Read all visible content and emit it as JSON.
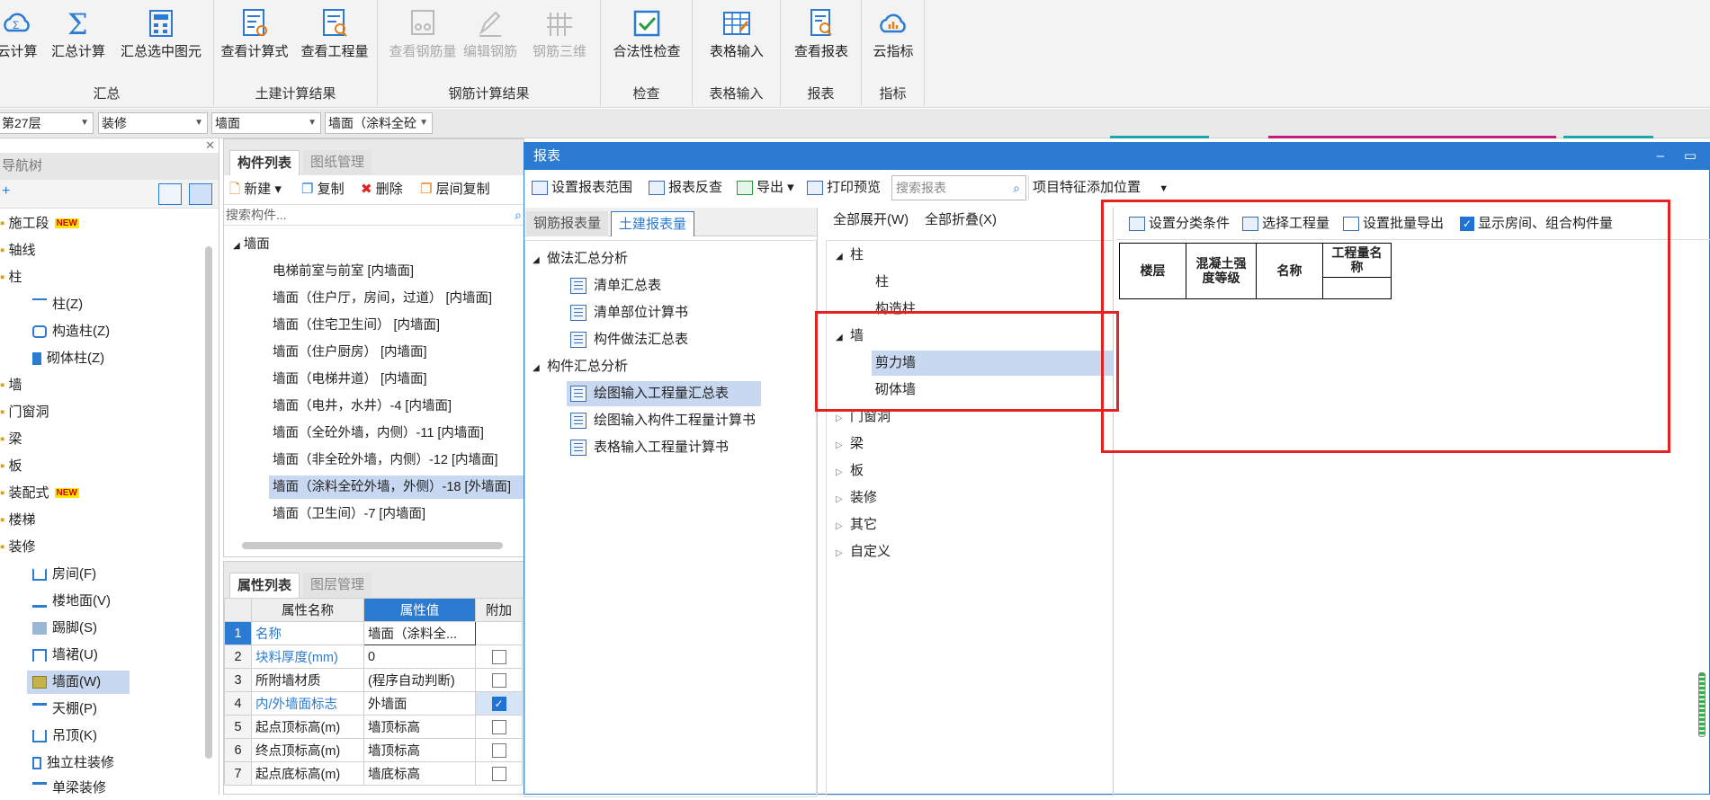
{
  "ribbon": {
    "groups": [
      {
        "label": "汇总",
        "buttons": [
          "云计算",
          "汇总计算",
          "汇总选中图元"
        ]
      },
      {
        "label": "土建计算结果",
        "buttons": [
          "查看计算式",
          "查看工程量"
        ]
      },
      {
        "label": "钢筋计算结果",
        "buttons": [
          "查看钢筋量",
          "编辑钢筋",
          "钢筋三维"
        ]
      },
      {
        "label": "检查",
        "buttons": [
          "合法性检查"
        ]
      },
      {
        "label": "表格输入",
        "buttons": [
          "表格输入"
        ]
      },
      {
        "label": "报表",
        "buttons": [
          "查看报表"
        ]
      },
      {
        "label": "指标",
        "buttons": [
          "云指标"
        ]
      }
    ]
  },
  "filter": {
    "floor": "第27层",
    "category": "装修",
    "type": "墙面",
    "item": "墙面（涂料全砼"
  },
  "nav": {
    "title": "导航树",
    "items": [
      "施工段",
      "轴线",
      "柱",
      "柱(Z)",
      "构造柱(Z)",
      "砌体柱(Z)",
      "墙",
      "门窗洞",
      "梁",
      "板",
      "装配式",
      "楼梯",
      "装修",
      "房间(F)",
      "楼地面(V)",
      "踢脚(S)",
      "墙裙(U)",
      "墙面(W)",
      "天棚(P)",
      "吊顶(K)",
      "独立柱装修",
      "单梁装修"
    ],
    "new_badge": "NEW"
  },
  "components": {
    "tabs": [
      "构件列表",
      "图纸管理"
    ],
    "toolbar": {
      "new": "新建",
      "copy": "复制",
      "delete": "删除",
      "floor_copy": "层间复制"
    },
    "search_placeholder": "搜索构件...",
    "root": "墙面",
    "items": [
      "电梯前室与前室 [内墙面]",
      "墙面（住户厅，房间，过道） [内墙面]",
      "墙面（住宅卫生间） [内墙面]",
      "墙面（住户厨房） [内墙面]",
      "墙面（电梯井道） [内墙面]",
      "墙面（电井，水井）-4 [内墙面]",
      "墙面（全砼外墙，内侧）-11 [内墙面]",
      "墙面（非全砼外墙，内侧）-12 [内墙面]",
      "墙面（涂料全砼外墙，外侧）-18 [外墙面]",
      "墙面（卫生间）-7 [内墙面]"
    ]
  },
  "properties": {
    "tabs": [
      "属性列表",
      "图层管理"
    ],
    "headers": [
      "属性名称",
      "属性值",
      "附加"
    ],
    "rows": [
      {
        "n": "1",
        "name": "名称",
        "value": "墙面（涂料全...",
        "extra": ""
      },
      {
        "n": "2",
        "name": "块料厚度(mm)",
        "value": "0",
        "extra": "unchecked"
      },
      {
        "n": "3",
        "name": "所附墙材质",
        "value": "(程序自动判断)",
        "extra": "unchecked"
      },
      {
        "n": "4",
        "name": "内/外墙面标志",
        "value": "外墙面",
        "extra": "checked"
      },
      {
        "n": "5",
        "name": "起点顶标高(m)",
        "value": "墙顶标高",
        "extra": "unchecked"
      },
      {
        "n": "6",
        "name": "终点顶标高(m)",
        "value": "墙顶标高",
        "extra": "unchecked"
      },
      {
        "n": "7",
        "name": "起点底标高(m)",
        "value": "墙底标高",
        "extra": "unchecked"
      }
    ]
  },
  "report": {
    "title": "报表",
    "toolbar": {
      "range": "设置报表范围",
      "reverse": "报表反查",
      "export": "导出",
      "preview": "打印预览",
      "search_placeholder": "搜索报表",
      "add_feature": "项目特征添加位置"
    },
    "tabs": [
      "钢筋报表量",
      "土建报表量"
    ],
    "tree": {
      "g1": "做法汇总分析",
      "g1_items": [
        "清单汇总表",
        "清单部位计算书",
        "构件做法汇总表"
      ],
      "g2": "构件汇总分析",
      "g2_items": [
        "绘图输入工程量汇总表",
        "绘图输入构件工程量计算书",
        "表格输入工程量计算书"
      ]
    },
    "cat_toolbar": {
      "expand": "全部展开(W)",
      "collapse": "全部折叠(X)"
    },
    "categories": {
      "col": "柱",
      "col_items": [
        "柱",
        "构造柱"
      ],
      "wall": "墙",
      "wall_items": [
        "剪力墙",
        "砌体墙"
      ],
      "rest": [
        "门窗洞",
        "梁",
        "板",
        "装修",
        "其它",
        "自定义"
      ]
    },
    "right_toolbar": {
      "classify": "设置分类条件",
      "select_qty": "选择工程量",
      "batch_export": "设置批量导出",
      "show_rooms": "显示房间、组合构件量"
    },
    "table_headers": [
      "楼层",
      "混凝土强度等级",
      "名称",
      "工程量名称"
    ]
  }
}
